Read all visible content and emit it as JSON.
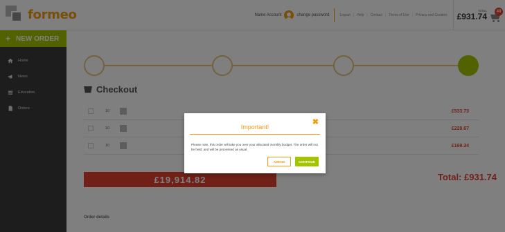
{
  "header": {
    "logo_text": "formeo",
    "user_name": "Name Account",
    "change_password": "change password",
    "links": [
      "Logout",
      "Help",
      "Contact",
      "Terms of Use",
      "Privacy and Cookies"
    ],
    "link_separator": "|",
    "basket": {
      "total_label": "TOTAL",
      "total_value": "£931.74",
      "count": "40"
    }
  },
  "sidebar": {
    "new_order": "NEW ORDER",
    "new_order_icon": "+",
    "items": [
      {
        "label": "Home",
        "icon": "home-icon"
      },
      {
        "label": "News",
        "icon": "megaphone-icon"
      },
      {
        "label": "Education",
        "icon": "list-icon"
      },
      {
        "label": "Orders",
        "icon": "document-icon"
      }
    ]
  },
  "main": {
    "page_title": "Checkout",
    "rows": [
      {
        "qty": "10",
        "price": "£533.73"
      },
      {
        "qty": "10",
        "price": "£228.67"
      },
      {
        "qty": "10",
        "price": "£169.34"
      }
    ],
    "budget_amount": "£19,914.82",
    "total": "Total: £931.74",
    "order_details": "Order details"
  },
  "modal": {
    "title": "Important!",
    "message": "Please note, this order will take you over your allocated monthly budget. The order will not be held, and will be processed as usual.",
    "amend_label": "AMEND",
    "continue_label": "CONTINUE",
    "close_glyph": "✖"
  },
  "colors": {
    "accent_orange": "#f39c12",
    "accent_green": "#a5c400",
    "sidebar_bg": "#3b3b3b",
    "alert_red": "#e0402f"
  }
}
